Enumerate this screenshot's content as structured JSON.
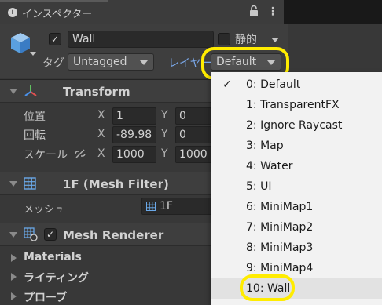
{
  "tab": {
    "title": "インスペクター"
  },
  "header": {
    "object_name": "Wall",
    "static_label": "静的",
    "tag_label": "タグ",
    "tag_value": "Untagged",
    "layer_label": "レイヤー",
    "layer_value": "Default"
  },
  "transform": {
    "title": "Transform",
    "rows": [
      {
        "label": "位置",
        "x": "1",
        "y": "0"
      },
      {
        "label": "回転",
        "x": "-89.98",
        "y": "0"
      },
      {
        "label": "スケール",
        "x": "1000",
        "y": "1000"
      }
    ],
    "axis_x": "X",
    "axis_y": "Y"
  },
  "mesh_filter": {
    "title": "1F (Mesh Filter)",
    "mesh_label": "メッシュ",
    "mesh_value": "1F"
  },
  "mesh_renderer": {
    "title": "Mesh Renderer",
    "sub_sections": [
      "Materials",
      "ライティング",
      "プローブ"
    ]
  },
  "layer_menu": {
    "selected_index": 0,
    "items": [
      "0: Default",
      "1: TransparentFX",
      "2: Ignore Raycast",
      "3: Map",
      "4: Water",
      "5: UI",
      "6: MiniMap1",
      "7: MiniMap2",
      "8: MiniMap3",
      "9: MiniMap4",
      "10: Wall"
    ],
    "check_mark": "✓"
  },
  "colors": {
    "highlight_ring": "#ffec00",
    "layer_label_blue": "#7aa7e8",
    "transform_icon_red": "#e05050",
    "transform_icon_green": "#60c060",
    "transform_icon_blue": "#4a90e8"
  }
}
